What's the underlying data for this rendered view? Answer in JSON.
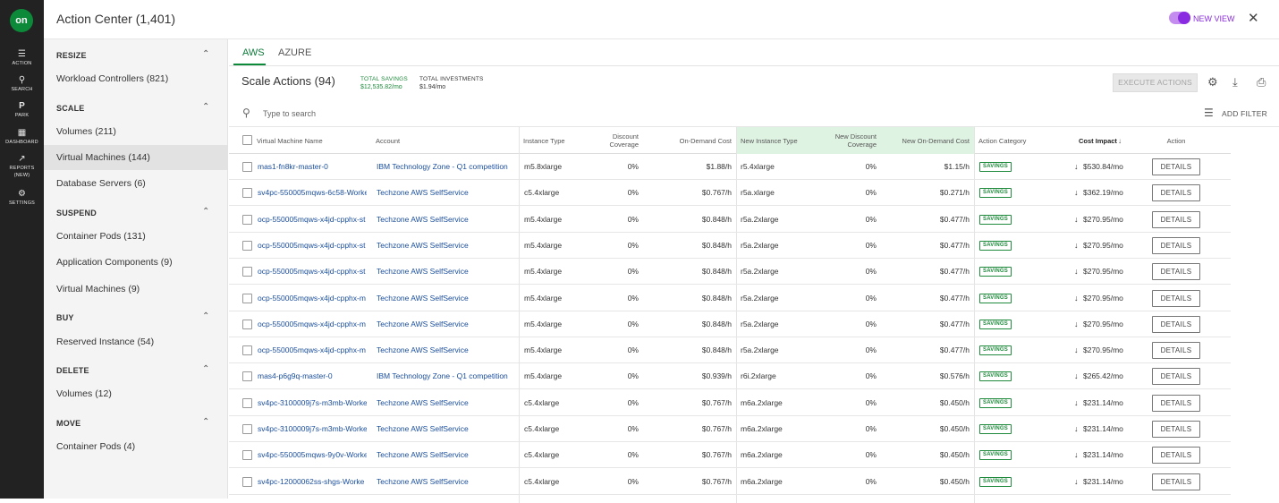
{
  "app": {
    "logo": "on",
    "title": "Action Center (1,401)",
    "new_view_label": "NEW VIEW",
    "close_icon": "close-icon"
  },
  "nav": [
    {
      "label": "ACTION",
      "icon": "action-icon"
    },
    {
      "label": "SEARCH",
      "icon": "search-icon"
    },
    {
      "label": "PARK",
      "icon": "park-icon"
    },
    {
      "label": "DASHBOARD",
      "icon": "dashboard-icon"
    },
    {
      "label": "REPORTS",
      "sublabel": "(NEW)",
      "icon": "reports-icon"
    },
    {
      "label": "SETTINGS",
      "icon": "settings-icon"
    }
  ],
  "sidebar": {
    "sections": [
      {
        "title": "RESIZE",
        "items": [
          "Workload Controllers (821)"
        ]
      },
      {
        "title": "SCALE",
        "items": [
          "Volumes (211)",
          "Virtual Machines (144)",
          "Database Servers (6)"
        ]
      },
      {
        "title": "SUSPEND",
        "items": [
          "Container Pods (131)",
          "Application Components (9)",
          "Virtual Machines (9)"
        ]
      },
      {
        "title": "BUY",
        "items": [
          "Reserved Instance (54)"
        ]
      },
      {
        "title": "DELETE",
        "items": [
          "Volumes (12)"
        ]
      },
      {
        "title": "MOVE",
        "items": [
          "Container Pods (4)"
        ]
      }
    ],
    "active_item": "Virtual Machines (144)"
  },
  "tabs": [
    "AWS",
    "AZURE"
  ],
  "active_tab": "AWS",
  "summary": {
    "title": "Scale Actions (94)",
    "total_savings_label": "TOTAL SAVINGS",
    "total_savings_value": "$12,535.82/mo",
    "total_investments_label": "TOTAL INVESTMENTS",
    "total_investments_value": "$1.94/mo",
    "execute_label": "EXECUTE ACTIONS",
    "savings_color": "#1f8a3c"
  },
  "search": {
    "placeholder": "Type to search",
    "add_filter_label": "ADD FILTER"
  },
  "table": {
    "columns": {
      "vm": "Virtual Machine Name",
      "account": "Account",
      "instance_type": "Instance Type",
      "discount": "Discount Coverage",
      "on_demand": "On-Demand Cost",
      "new_instance": "New Instance Type",
      "new_discount": "New Discount Coverage",
      "new_on_demand": "New On-Demand Cost",
      "category": "Action Category",
      "impact": "Cost Impact",
      "action": "Action"
    },
    "details_label": "DETAILS",
    "rows": [
      {
        "vm": "mas1-fn8kr-master-0",
        "account": "IBM Technology Zone - Q1 competition",
        "instance": "m5.8xlarge",
        "discount": "0%",
        "cost": "$1.88/h",
        "new_instance": "r5.4xlarge",
        "new_discount": "0%",
        "new_cost": "$1.15/h",
        "category": "SAVINGS",
        "impact": "$530.84/mo"
      },
      {
        "vm": "sv4pc-550005mqws-6c58-Worke",
        "account": "Techzone AWS SelfService",
        "instance": "c5.4xlarge",
        "discount": "0%",
        "cost": "$0.767/h",
        "new_instance": "r5a.xlarge",
        "new_discount": "0%",
        "new_cost": "$0.271/h",
        "category": "SAVINGS",
        "impact": "$362.19/mo"
      },
      {
        "vm": "ocp-550005mqws-x4jd-cpphx-st",
        "account": "Techzone AWS SelfService",
        "instance": "m5.4xlarge",
        "discount": "0%",
        "cost": "$0.848/h",
        "new_instance": "r5a.2xlarge",
        "new_discount": "0%",
        "new_cost": "$0.477/h",
        "category": "SAVINGS",
        "impact": "$270.95/mo"
      },
      {
        "vm": "ocp-550005mqws-x4jd-cpphx-st",
        "account": "Techzone AWS SelfService",
        "instance": "m5.4xlarge",
        "discount": "0%",
        "cost": "$0.848/h",
        "new_instance": "r5a.2xlarge",
        "new_discount": "0%",
        "new_cost": "$0.477/h",
        "category": "SAVINGS",
        "impact": "$270.95/mo"
      },
      {
        "vm": "ocp-550005mqws-x4jd-cpphx-st",
        "account": "Techzone AWS SelfService",
        "instance": "m5.4xlarge",
        "discount": "0%",
        "cost": "$0.848/h",
        "new_instance": "r5a.2xlarge",
        "new_discount": "0%",
        "new_cost": "$0.477/h",
        "category": "SAVINGS",
        "impact": "$270.95/mo"
      },
      {
        "vm": "ocp-550005mqws-x4jd-cpphx-m",
        "account": "Techzone AWS SelfService",
        "instance": "m5.4xlarge",
        "discount": "0%",
        "cost": "$0.848/h",
        "new_instance": "r5a.2xlarge",
        "new_discount": "0%",
        "new_cost": "$0.477/h",
        "category": "SAVINGS",
        "impact": "$270.95/mo"
      },
      {
        "vm": "ocp-550005mqws-x4jd-cpphx-m",
        "account": "Techzone AWS SelfService",
        "instance": "m5.4xlarge",
        "discount": "0%",
        "cost": "$0.848/h",
        "new_instance": "r5a.2xlarge",
        "new_discount": "0%",
        "new_cost": "$0.477/h",
        "category": "SAVINGS",
        "impact": "$270.95/mo"
      },
      {
        "vm": "ocp-550005mqws-x4jd-cpphx-m",
        "account": "Techzone AWS SelfService",
        "instance": "m5.4xlarge",
        "discount": "0%",
        "cost": "$0.848/h",
        "new_instance": "r5a.2xlarge",
        "new_discount": "0%",
        "new_cost": "$0.477/h",
        "category": "SAVINGS",
        "impact": "$270.95/mo"
      },
      {
        "vm": "mas4-p6g9q-master-0",
        "account": "IBM Technology Zone - Q1 competition",
        "instance": "m5.4xlarge",
        "discount": "0%",
        "cost": "$0.939/h",
        "new_instance": "r6i.2xlarge",
        "new_discount": "0%",
        "new_cost": "$0.576/h",
        "category": "SAVINGS",
        "impact": "$265.42/mo"
      },
      {
        "vm": "sv4pc-3100009j7s-m3mb-Worke",
        "account": "Techzone AWS SelfService",
        "instance": "c5.4xlarge",
        "discount": "0%",
        "cost": "$0.767/h",
        "new_instance": "m6a.2xlarge",
        "new_discount": "0%",
        "new_cost": "$0.450/h",
        "category": "SAVINGS",
        "impact": "$231.14/mo"
      },
      {
        "vm": "sv4pc-3100009j7s-m3mb-Worke",
        "account": "Techzone AWS SelfService",
        "instance": "c5.4xlarge",
        "discount": "0%",
        "cost": "$0.767/h",
        "new_instance": "m6a.2xlarge",
        "new_discount": "0%",
        "new_cost": "$0.450/h",
        "category": "SAVINGS",
        "impact": "$231.14/mo"
      },
      {
        "vm": "sv4pc-550005mqws-9y0v-Worke",
        "account": "Techzone AWS SelfService",
        "instance": "c5.4xlarge",
        "discount": "0%",
        "cost": "$0.767/h",
        "new_instance": "m6a.2xlarge",
        "new_discount": "0%",
        "new_cost": "$0.450/h",
        "category": "SAVINGS",
        "impact": "$231.14/mo"
      },
      {
        "vm": "sv4pc-12000062ss-shgs-Worke",
        "account": "Techzone AWS SelfService",
        "instance": "c5.4xlarge",
        "discount": "0%",
        "cost": "$0.767/h",
        "new_instance": "m6a.2xlarge",
        "new_discount": "0%",
        "new_cost": "$0.450/h",
        "category": "SAVINGS",
        "impact": "$231.14/mo"
      }
    ]
  }
}
